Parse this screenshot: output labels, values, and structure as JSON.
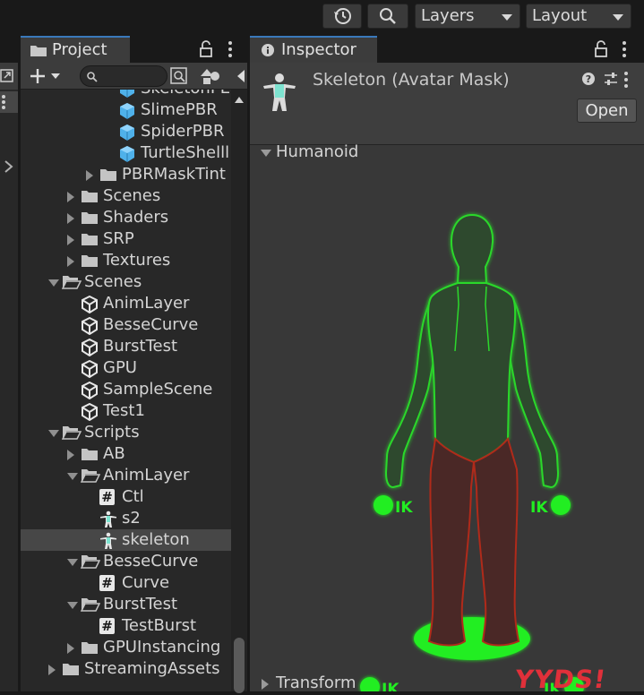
{
  "toolbar": {
    "history_icon": "history-icon",
    "search_icon": "search-icon",
    "layers_label": "Layers",
    "layout_label": "Layout"
  },
  "project_panel": {
    "tab_label": "Project",
    "search_placeholder": "",
    "tree": [
      {
        "label": "SkeletonPE",
        "icon": "prefab-icon",
        "indent": 4,
        "arrow": "none"
      },
      {
        "label": "SlimePBR",
        "icon": "prefab-icon",
        "indent": 4,
        "arrow": "none"
      },
      {
        "label": "SpiderPBR",
        "icon": "prefab-icon",
        "indent": 4,
        "arrow": "none"
      },
      {
        "label": "TurtleShelll",
        "icon": "prefab-icon",
        "indent": 4,
        "arrow": "none"
      },
      {
        "label": "PBRMaskTint",
        "icon": "folder-icon",
        "indent": 3,
        "arrow": "right"
      },
      {
        "label": "Scenes",
        "icon": "folder-icon",
        "indent": 2,
        "arrow": "right"
      },
      {
        "label": "Shaders",
        "icon": "folder-icon",
        "indent": 2,
        "arrow": "right"
      },
      {
        "label": "SRP",
        "icon": "folder-icon",
        "indent": 2,
        "arrow": "right"
      },
      {
        "label": "Textures",
        "icon": "folder-icon",
        "indent": 2,
        "arrow": "right"
      },
      {
        "label": "Scenes",
        "icon": "folder-open-icon",
        "indent": 1,
        "arrow": "down"
      },
      {
        "label": "AnimLayer",
        "icon": "scene-icon",
        "indent": 2,
        "arrow": "none"
      },
      {
        "label": "BesseCurve",
        "icon": "scene-icon",
        "indent": 2,
        "arrow": "none"
      },
      {
        "label": "BurstTest",
        "icon": "scene-icon",
        "indent": 2,
        "arrow": "none"
      },
      {
        "label": "GPU",
        "icon": "scene-icon",
        "indent": 2,
        "arrow": "none"
      },
      {
        "label": "SampleScene",
        "icon": "scene-icon",
        "indent": 2,
        "arrow": "none"
      },
      {
        "label": "Test1",
        "icon": "scene-icon",
        "indent": 2,
        "arrow": "none"
      },
      {
        "label": "Scripts",
        "icon": "folder-open-icon",
        "indent": 1,
        "arrow": "down"
      },
      {
        "label": "AB",
        "icon": "folder-icon",
        "indent": 2,
        "arrow": "right"
      },
      {
        "label": "AnimLayer",
        "icon": "folder-open-icon",
        "indent": 2,
        "arrow": "down"
      },
      {
        "label": "Ctl",
        "icon": "script-icon",
        "indent": 3,
        "arrow": "none"
      },
      {
        "label": "s2",
        "icon": "avatar-mask-icon",
        "indent": 3,
        "arrow": "none"
      },
      {
        "label": "skeleton",
        "icon": "avatar-mask-icon",
        "indent": 3,
        "arrow": "none",
        "selected": true
      },
      {
        "label": "BesseCurve",
        "icon": "folder-open-icon",
        "indent": 2,
        "arrow": "down"
      },
      {
        "label": "Curve",
        "icon": "script-icon",
        "indent": 3,
        "arrow": "none"
      },
      {
        "label": "BurstTest",
        "icon": "folder-open-icon",
        "indent": 2,
        "arrow": "down"
      },
      {
        "label": "TestBurst",
        "icon": "script-icon",
        "indent": 3,
        "arrow": "none"
      },
      {
        "label": "GPUInstancing",
        "icon": "folder-icon",
        "indent": 2,
        "arrow": "right"
      },
      {
        "label": "StreamingAssets",
        "icon": "folder-icon",
        "indent": 1,
        "arrow": "right"
      }
    ]
  },
  "inspector": {
    "tab_label": "Inspector",
    "asset_title": "Skeleton (Avatar Mask)",
    "open_button": "Open",
    "humanoid_section": "Humanoid",
    "transform_section": "Transform",
    "ik_label": "IK",
    "watermark": "YYDS!"
  },
  "colors": {
    "accent_tab": "#3a79bb",
    "mask_green": "#2cd82c",
    "mask_green_fill": "#2f4a2f",
    "mask_red": "#b02a1a",
    "mask_red_fill": "#4a2826",
    "watermark": "#e0303a"
  }
}
